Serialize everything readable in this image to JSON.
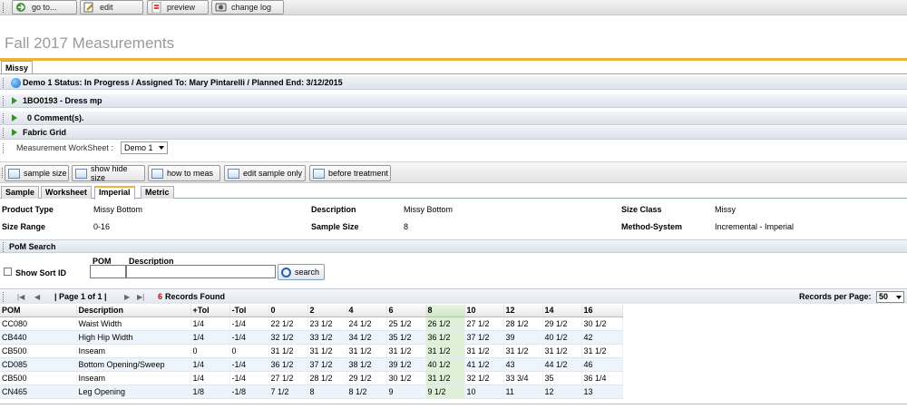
{
  "toolbar": {
    "buttons": [
      {
        "label": "go to...",
        "icon": "go-to-icon"
      },
      {
        "label": "edit",
        "icon": "edit-icon"
      },
      {
        "label": "preview",
        "icon": "pdf-icon"
      },
      {
        "label": "change log",
        "icon": "change-log-icon"
      }
    ]
  },
  "page": {
    "title": "Fall 2017 Measurements",
    "tab": "Missy"
  },
  "info_rows": {
    "status": "Demo 1  Status: In Progress / Assigned To: Mary Pintarelli / Planned End: 3/12/2015",
    "style": "1BO0193 - Dress mp",
    "comments": "0 Comment(s).",
    "fabric": "Fabric Grid"
  },
  "worksheet": {
    "label": "Measurement WorkSheet :",
    "selected": "Demo 1"
  },
  "toolbar2": {
    "buttons": [
      "sample size",
      "show hide size",
      "how to meas",
      "edit sample only",
      "before treatment"
    ]
  },
  "subtabs": [
    "Sample",
    "Worksheet",
    "Imperial",
    "Metric"
  ],
  "active_subtab": "Imperial",
  "product": {
    "product_type_label": "Product Type",
    "product_type": "Missy Bottom",
    "description_label": "Description",
    "description": "Missy Bottom",
    "size_class_label": "Size Class",
    "size_class": "Missy",
    "size_range_label": "Size Range",
    "size_range": "0-16",
    "sample_size_label": "Sample Size",
    "sample_size": "8",
    "method_label": "Method-System",
    "method": "Incremental - Imperial"
  },
  "pom_search": {
    "title": "PoM Search",
    "show_sort_id": "Show Sort ID",
    "pom_label": "POM",
    "description_label": "Description",
    "pom_value": "",
    "description_value": "",
    "search_button": "search"
  },
  "pager": {
    "page_text": "| Page 1 of 1 |",
    "records_count": "6",
    "records_text": "Records Found",
    "rpp_label": "Records per Page:",
    "rpp_value": "50"
  },
  "table": {
    "headers": [
      "POM",
      "Description",
      "+Tol",
      "-Tol",
      "0",
      "2",
      "4",
      "6",
      "8",
      "10",
      "12",
      "14",
      "16"
    ],
    "highlight_col": 8,
    "rows": [
      [
        "CC080",
        "Waist Width",
        "1/4",
        "-1/4",
        "22 1/2",
        "23 1/2",
        "24 1/2",
        "25 1/2",
        "26 1/2",
        "27 1/2",
        "28 1/2",
        "29 1/2",
        "30 1/2"
      ],
      [
        "CB440",
        "High Hip Width",
        "1/4",
        "-1/4",
        "32 1/2",
        "33 1/2",
        "34 1/2",
        "35 1/2",
        "36 1/2",
        "37 1/2",
        "39",
        "40 1/2",
        "42"
      ],
      [
        "CB500",
        "Inseam",
        "0",
        "0",
        "31 1/2",
        "31 1/2",
        "31 1/2",
        "31 1/2",
        "31 1/2",
        "31 1/2",
        "31 1/2",
        "31 1/2",
        "31 1/2"
      ],
      [
        "CD085",
        "Bottom Opening/Sweep",
        "1/4",
        "-1/4",
        "36 1/2",
        "37 1/2",
        "38 1/2",
        "39 1/2",
        "40 1/2",
        "41 1/2",
        "43",
        "44 1/2",
        "46"
      ],
      [
        "CB500",
        "Inseam",
        "1/4",
        "-1/4",
        "27 1/2",
        "28 1/2",
        "29 1/2",
        "30 1/2",
        "31 1/2",
        "32 1/2",
        "33 3/4",
        "35",
        "36 1/4"
      ],
      [
        "CN465",
        "Leg Opening",
        "1/8",
        "-1/8",
        "7 1/2",
        "8",
        "8 1/2",
        "9",
        "9 1/2",
        "10",
        "11",
        "12",
        "13"
      ]
    ]
  },
  "colors": {
    "accent": "#e8b53a",
    "active_col": "#dff0d8",
    "records_count": "#cc0000",
    "arrow": "#2d9a1e"
  }
}
